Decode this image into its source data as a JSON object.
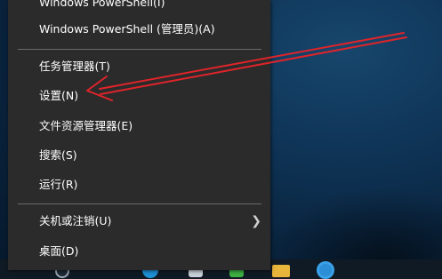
{
  "menu": {
    "items": [
      {
        "id": "powershell",
        "label": "Windows PowerShell(I)"
      },
      {
        "id": "powershell-admin",
        "label": "Windows PowerShell (管理员)(A)"
      },
      {
        "id": "task-manager",
        "label": "任务管理器(T)"
      },
      {
        "id": "settings",
        "label": "设置(N)"
      },
      {
        "id": "file-explorer",
        "label": "文件资源管理器(E)"
      },
      {
        "id": "search",
        "label": "搜索(S)"
      },
      {
        "id": "run",
        "label": "运行(R)"
      },
      {
        "id": "shutdown",
        "label": "关机或注销(U)",
        "submenu_icon": "chevron-right-icon"
      },
      {
        "id": "desktop",
        "label": "桌面(D)"
      }
    ]
  },
  "annotation": {
    "arrow_color": "#e0242a",
    "target": "settings"
  },
  "taskbar": {
    "icons": [
      "search-icon",
      "edge-icon",
      "store-icon",
      "app-icon",
      "file-explorer-icon",
      "browser-icon"
    ]
  }
}
